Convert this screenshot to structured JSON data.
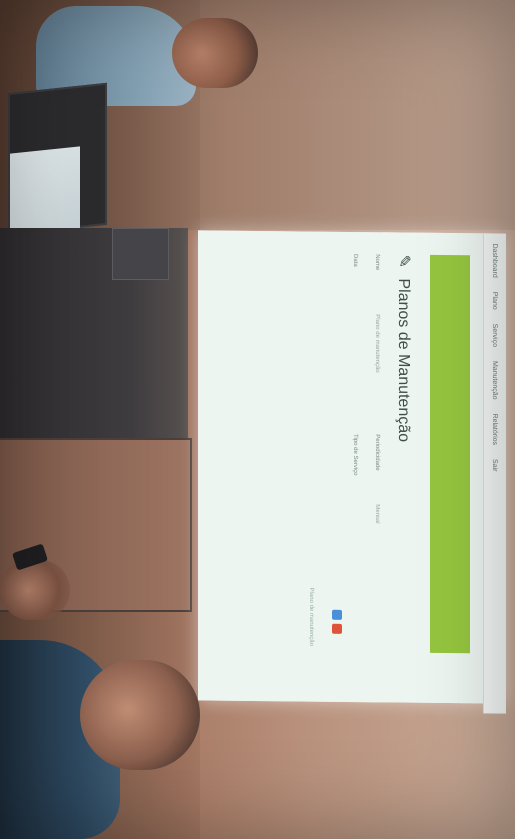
{
  "screen": {
    "nav_items": [
      "Dashboard",
      "Plano",
      "Serviço",
      "Manutenção",
      "Relatórios",
      "Sair"
    ],
    "page_title": "Planos de Manutenção",
    "fields": [
      {
        "label": "Nome",
        "value": "Plano de manutenção"
      },
      {
        "label": "Periodicidade",
        "value": "Mensal"
      },
      {
        "label": "Data",
        "value": ""
      },
      {
        "label": "Tipo de Serviço",
        "value": ""
      }
    ],
    "footer_note": "Plano de manutenção",
    "accent_green": "#95c53f"
  }
}
